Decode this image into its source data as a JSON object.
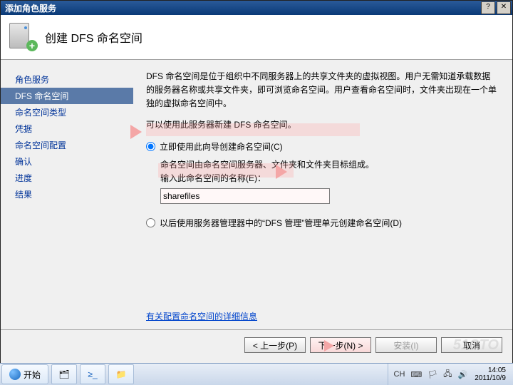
{
  "window": {
    "title": "添加角色服务",
    "close": "✕",
    "help": "?"
  },
  "header": {
    "title": "创建 DFS 命名空间"
  },
  "nav": {
    "items": [
      {
        "label": "角色服务"
      },
      {
        "label": "DFS 命名空间"
      },
      {
        "label": "命名空间类型"
      },
      {
        "label": "凭据"
      },
      {
        "label": "命名空间配置"
      },
      {
        "label": "确认"
      },
      {
        "label": "进度"
      },
      {
        "label": "结果"
      }
    ],
    "selected_index": 1
  },
  "content": {
    "desc": "DFS 命名空间是位于组织中不同服务器上的共享文件夹的虚拟视图。用户无需知道承载数据的服务器名称或共享文件夹，即可浏览命名空间。用户查看命名空间时，文件夹出现在一个单独的虚拟命名空间中。",
    "sub": "可以使用此服务器新建 DFS 命名空间。",
    "opt1": {
      "label": "立即使用此向导创建命名空间(C)"
    },
    "opt1_desc": "命名空间由命名空间服务器、文件夹和文件夹目标组成。",
    "name_label": "输入此命名空间的名称(E)：",
    "name_value": "sharefiles",
    "opt2": {
      "label": "以后使用服务器管理器中的“DFS 管理”管理单元创建命名空间(D)"
    },
    "link": "有关配置命名空间的详细信息"
  },
  "footer": {
    "prev": "< 上一步(P)",
    "next": "下一步(N) >",
    "install": "安装(I)",
    "cancel": "取消"
  },
  "taskbar": {
    "start": "开始",
    "lang": "CH",
    "time": "14:05",
    "date": "2011/10/9"
  },
  "watermark": "51CTO"
}
